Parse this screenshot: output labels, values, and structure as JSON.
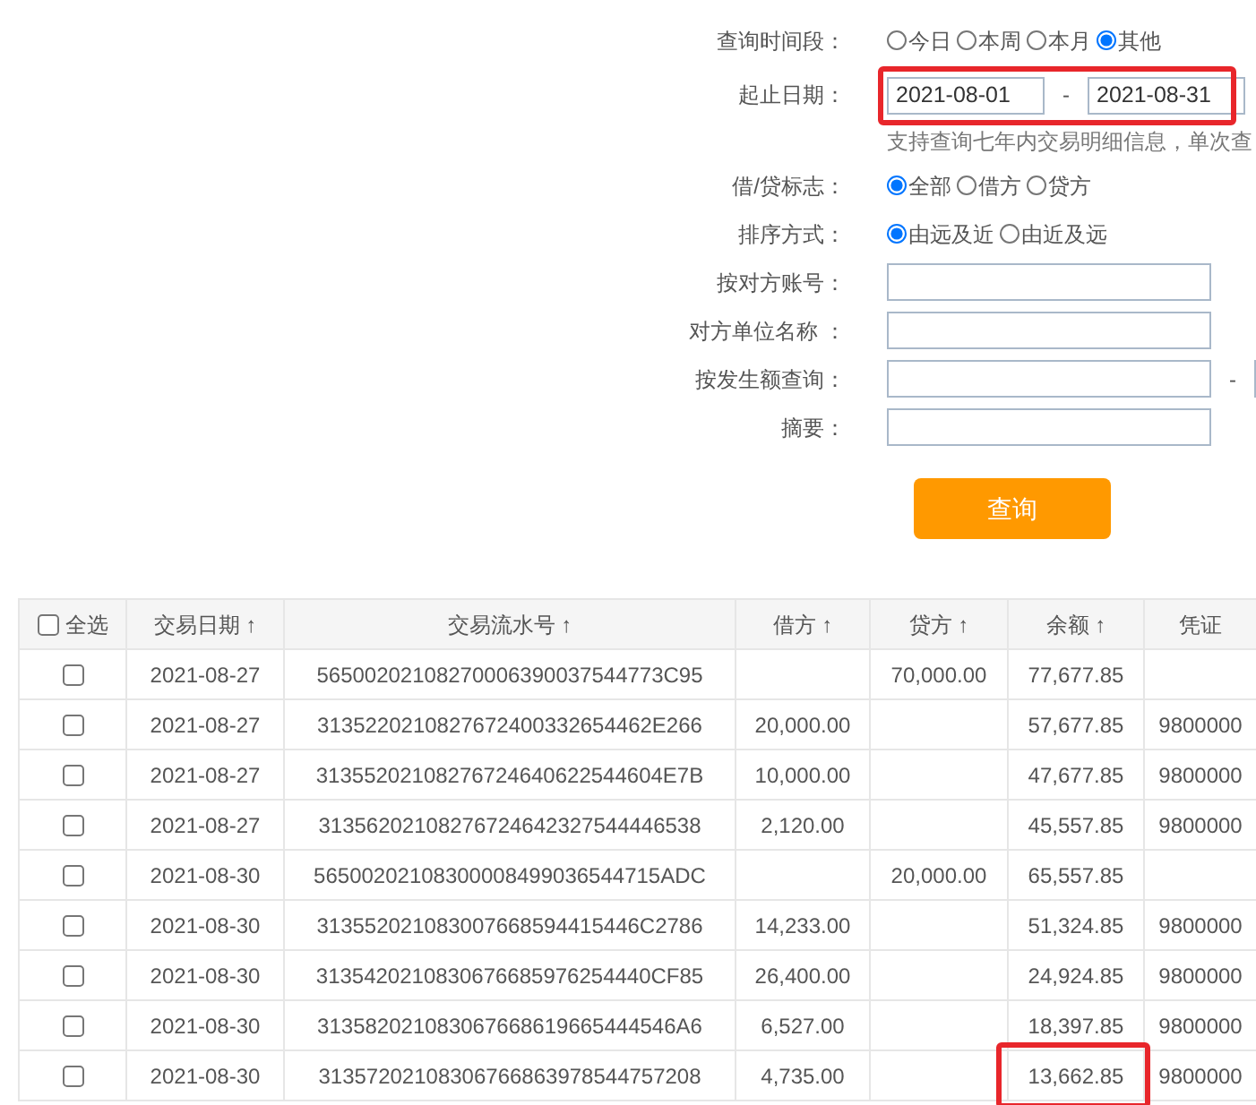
{
  "filters": {
    "period": {
      "label": "查询时间段：",
      "options": [
        {
          "label": "今日",
          "selected": false
        },
        {
          "label": "本周",
          "selected": false
        },
        {
          "label": "本月",
          "selected": false
        },
        {
          "label": "其他",
          "selected": true
        }
      ]
    },
    "date_range": {
      "label": "起止日期：",
      "start": "2021-08-01",
      "separator": "-",
      "end": "2021-08-31",
      "highlighted": true
    },
    "hint": "支持查询七年内交易明细信息，单次查",
    "debit_credit": {
      "label": "借/贷标志：",
      "options": [
        {
          "label": "全部",
          "selected": true
        },
        {
          "label": "借方",
          "selected": false
        },
        {
          "label": "贷方",
          "selected": false
        }
      ]
    },
    "sort_order": {
      "label": "排序方式：",
      "options": [
        {
          "label": "由远及近",
          "selected": true
        },
        {
          "label": "由近及远",
          "selected": false
        }
      ]
    },
    "counterparty_account": {
      "label": "按对方账号："
    },
    "counterparty_name": {
      "label": "对方单位名称 ："
    },
    "amount": {
      "label": "按发生额查询：",
      "separator": "-"
    },
    "summary": {
      "label": "摘要："
    }
  },
  "query_button": "查询",
  "table": {
    "select_all": {
      "label": "全选",
      "checked": false
    },
    "columns": [
      {
        "label": "交易日期",
        "sort": "↑"
      },
      {
        "label": "交易流水号",
        "sort": "↑"
      },
      {
        "label": "借方",
        "sort": "↑"
      },
      {
        "label": "贷方",
        "sort": "↑"
      },
      {
        "label": "余额",
        "sort": "↑"
      },
      {
        "label": "凭证"
      }
    ],
    "rows": [
      {
        "checked": false,
        "cells": [
          "2021-08-27",
          "56500202108270006390037544773C95",
          "",
          "70,000.00",
          "77,677.85",
          ""
        ],
        "balance_highlighted": false
      },
      {
        "checked": false,
        "cells": [
          "2021-08-27",
          "3135220210827672400332654462E266",
          "20,000.00",
          "",
          "57,677.85",
          "9800000"
        ],
        "balance_highlighted": false
      },
      {
        "checked": false,
        "cells": [
          "2021-08-27",
          "31355202108276724640622544604E7B",
          "10,000.00",
          "",
          "47,677.85",
          "9800000"
        ],
        "balance_highlighted": false
      },
      {
        "checked": false,
        "cells": [
          "2021-08-27",
          "31356202108276724642327544446538",
          "2,120.00",
          "",
          "45,557.85",
          "9800000"
        ],
        "balance_highlighted": false
      },
      {
        "checked": false,
        "cells": [
          "2021-08-30",
          "56500202108300008499036544715ADC",
          "",
          "20,000.00",
          "65,557.85",
          ""
        ],
        "balance_highlighted": false
      },
      {
        "checked": false,
        "cells": [
          "2021-08-30",
          "313552021083007668594415446C2786",
          "14,233.00",
          "",
          "51,324.85",
          "9800000"
        ],
        "balance_highlighted": false
      },
      {
        "checked": false,
        "cells": [
          "2021-08-30",
          "3135420210830676685976254440CF85",
          "26,400.00",
          "",
          "24,924.85",
          "9800000"
        ],
        "balance_highlighted": false
      },
      {
        "checked": false,
        "cells": [
          "2021-08-30",
          "313582021083067668619665444546A6",
          "6,527.00",
          "",
          "18,397.85",
          "9800000"
        ],
        "balance_highlighted": false
      },
      {
        "checked": false,
        "cells": [
          "2021-08-30",
          "31357202108306766863978544757208",
          "4,735.00",
          "",
          "13,662.85",
          "9800000"
        ],
        "balance_highlighted": true
      }
    ]
  }
}
